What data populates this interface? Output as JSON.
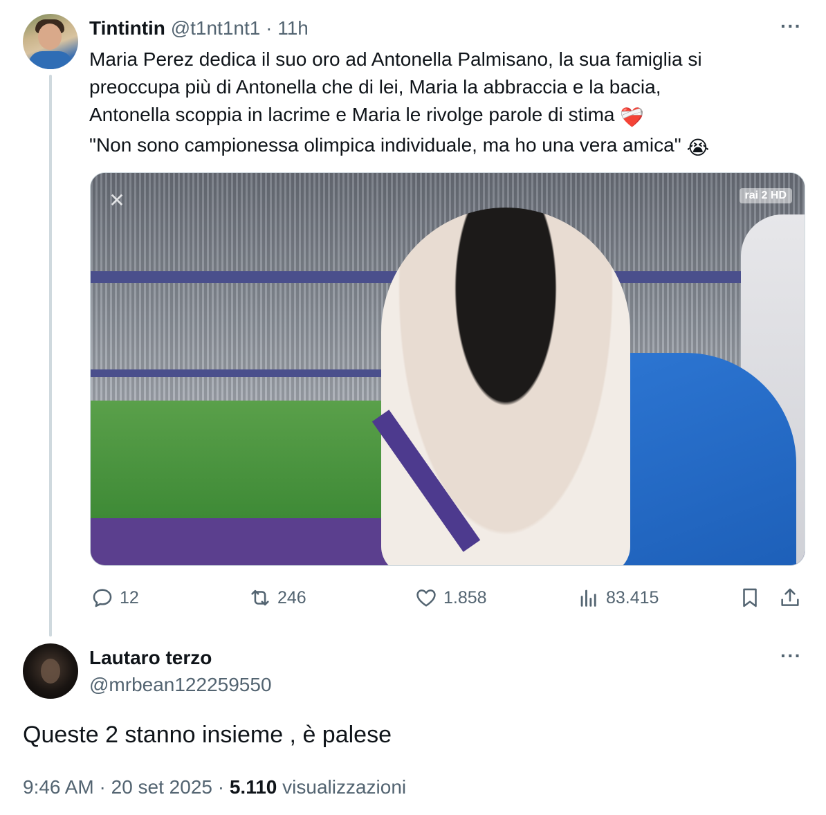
{
  "tweet1": {
    "display_name": "Tintintin",
    "handle": "@t1nt1nt1",
    "time": "11h",
    "separator": "·",
    "lines": [
      "Maria Perez dedica il suo oro ad Antonella Palmisano, la sua famiglia si",
      "preoccupa più di Antonella che di lei, Maria la abbraccia e la bacia,",
      "Antonella scoppia in lacrime e Maria le rivolge parole di stima",
      "\"Non sono campionessa olimpica individuale, ma ho una vera amica\""
    ],
    "emoji_line3": "❤️‍🩹",
    "emoji_line4": "😭",
    "media": {
      "icon": "capcut-logo-icon",
      "watermark": "rai 2 HD"
    },
    "actions": {
      "replies": "12",
      "reposts": "246",
      "likes": "1.858",
      "views": "83.415"
    }
  },
  "tweet2": {
    "display_name": "Lautaro terzo",
    "handle": "@mrbean122259550",
    "text": "Queste 2 stanno insieme , è palese",
    "time": "9:46 AM",
    "date": "20 set 2025",
    "separator": "·",
    "views_count": "5.110",
    "views_label": "visualizzazioni"
  },
  "more_label": "···",
  "colors": {
    "text": "#0f1419",
    "secondary": "#536471",
    "thread_line": "#cfd9de"
  }
}
